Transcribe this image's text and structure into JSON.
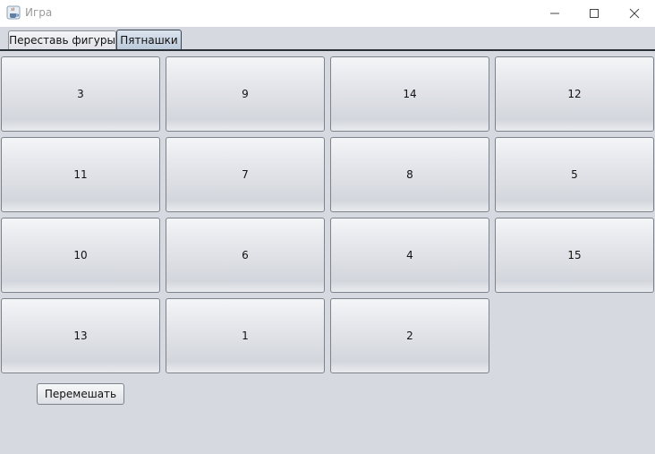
{
  "window": {
    "title": "Игра",
    "controls": [
      "minimize-icon",
      "maximize-icon",
      "close-icon"
    ]
  },
  "tabs": [
    {
      "label": "Переставь фигуры",
      "active": false
    },
    {
      "label": "Пятнашки",
      "active": true
    }
  ],
  "board": {
    "rows": [
      [
        "3",
        "9",
        "14",
        "12"
      ],
      [
        "11",
        "7",
        "8",
        "5"
      ],
      [
        "10",
        "6",
        "4",
        "15"
      ],
      [
        "13",
        "1",
        "2",
        ""
      ]
    ]
  },
  "shuffle_button": {
    "label": "Перемешать"
  }
}
